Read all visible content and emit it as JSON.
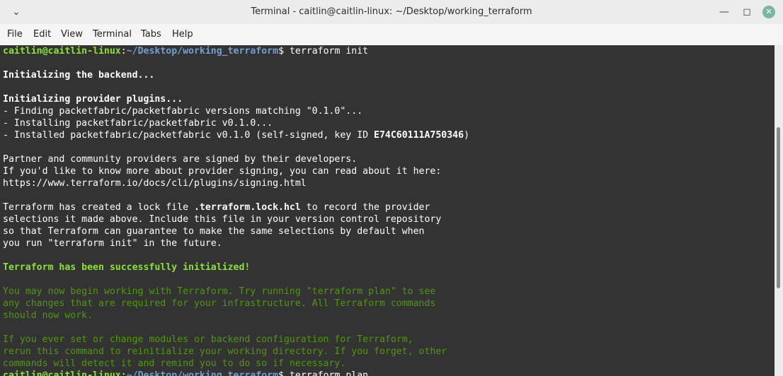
{
  "window": {
    "title": "Terminal - caitlin@caitlin-linux: ~/Desktop/working_terraform",
    "menu_icon": "chevron-down-icon",
    "minimize_icon": "minimize-icon",
    "maximize_icon": "maximize-icon",
    "close_icon": "close-icon",
    "close_color": "#7ab7a3"
  },
  "menu": {
    "items": [
      "File",
      "Edit",
      "View",
      "Terminal",
      "Tabs",
      "Help"
    ]
  },
  "colors": {
    "terminal_bg": "#333333",
    "prompt_user": "#8ae234",
    "prompt_path": "#729fcf",
    "success_green": "#8ae234",
    "hint_green": "#4e9a06",
    "text": "#ffffff"
  },
  "terminal": {
    "lines": [
      [
        {
          "text": "caitlin@caitlin-linux",
          "color": "#8ae234",
          "bold": true
        },
        {
          "text": ":",
          "color": "#ffffff"
        },
        {
          "text": "~/Desktop/working_terraform",
          "color": "#729fcf",
          "bold": true
        },
        {
          "text": "$ terraform init",
          "color": "#ffffff"
        }
      ],
      [],
      [
        {
          "text": "Initializing the backend...",
          "bold": true
        }
      ],
      [],
      [
        {
          "text": "Initializing provider plugins...",
          "bold": true
        }
      ],
      [
        {
          "text": "- Finding packetfabric/packetfabric versions matching \"0.1.0\"..."
        }
      ],
      [
        {
          "text": "- Installing packetfabric/packetfabric v0.1.0..."
        }
      ],
      [
        {
          "text": "- Installed packetfabric/packetfabric v0.1.0 (self-signed, key ID "
        },
        {
          "text": "E74C60111A750346",
          "bold": true
        },
        {
          "text": ")"
        }
      ],
      [],
      [
        {
          "text": "Partner and community providers are signed by their developers."
        }
      ],
      [
        {
          "text": "If you'd like to know more about provider signing, you can read about it here:"
        }
      ],
      [
        {
          "text": "https://www.terraform.io/docs/cli/plugins/signing.html"
        }
      ],
      [],
      [
        {
          "text": "Terraform has created a lock file "
        },
        {
          "text": ".terraform.lock.hcl",
          "bold": true
        },
        {
          "text": " to record the provider"
        }
      ],
      [
        {
          "text": "selections it made above. Include this file in your version control repository"
        }
      ],
      [
        {
          "text": "so that Terraform can guarantee to make the same selections by default when"
        }
      ],
      [
        {
          "text": "you run \"terraform init\" in the future."
        }
      ],
      [],
      [
        {
          "text": "Terraform has been successfully initialized!",
          "color": "#8ae234",
          "bold": true
        }
      ],
      [],
      [
        {
          "text": "You may now begin working with Terraform. Try running \"terraform plan\" to see",
          "color": "#4e9a06"
        }
      ],
      [
        {
          "text": "any changes that are required for your infrastructure. All Terraform commands",
          "color": "#4e9a06"
        }
      ],
      [
        {
          "text": "should now work.",
          "color": "#4e9a06"
        }
      ],
      [],
      [
        {
          "text": "If you ever set or change modules or backend configuration for Terraform,",
          "color": "#4e9a06"
        }
      ],
      [
        {
          "text": "rerun this command to reinitialize your working directory. If you forget, other",
          "color": "#4e9a06"
        }
      ],
      [
        {
          "text": "commands will detect it and remind you to do so if necessary.",
          "color": "#4e9a06"
        }
      ],
      [
        {
          "text": "caitlin@caitlin-linux",
          "color": "#8ae234",
          "bold": true
        },
        {
          "text": ":",
          "color": "#ffffff"
        },
        {
          "text": "~/Desktop/working_terraform",
          "color": "#729fcf",
          "bold": true
        },
        {
          "text": "$ terraform plan",
          "color": "#ffffff"
        }
      ]
    ]
  }
}
